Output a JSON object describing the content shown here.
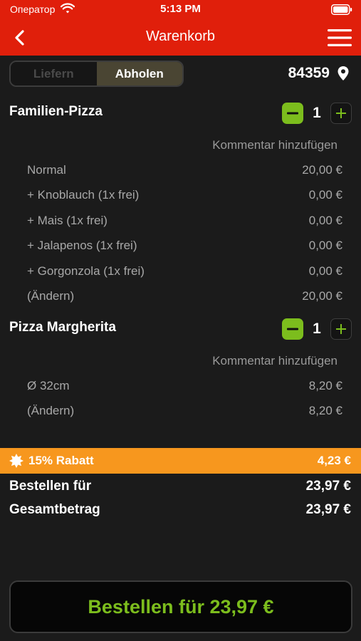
{
  "status_bar": {
    "carrier": "Оператор",
    "time": "5:13 PM"
  },
  "nav": {
    "title": "Warenkorb"
  },
  "mode": {
    "delivery": "Liefern",
    "pickup": "Abholen",
    "selected": "Abholen"
  },
  "location": {
    "zip": "84359"
  },
  "cart": {
    "items": [
      {
        "name": "Familien-Pizza",
        "quantity": "1",
        "comment": "Kommentar hinzufügen",
        "lines": [
          {
            "label": "Normal",
            "price": "20,00 €"
          },
          {
            "label": "+ Knoblauch (1x frei)",
            "price": "0,00 €"
          },
          {
            "label": "+ Mais (1x frei)",
            "price": "0,00 €"
          },
          {
            "label": "+ Jalapenos (1x frei)",
            "price": "0,00 €"
          },
          {
            "label": "+ Gorgonzola (1x frei)",
            "price": "0,00 €"
          },
          {
            "label": "(Ändern)",
            "price": "20,00 €"
          }
        ]
      },
      {
        "name": "Pizza Margherita",
        "quantity": "1",
        "comment": "Kommentar hinzufügen",
        "lines": [
          {
            "label": "Ø 32cm",
            "price": "8,20 €"
          },
          {
            "label": "(Ändern)",
            "price": "8,20 €"
          }
        ]
      }
    ]
  },
  "discount": {
    "label": "15% Rabatt",
    "value": "4,23 €"
  },
  "summary": {
    "order_for_label": "Bestellen für",
    "order_for_value": "23,97 €",
    "total_label": "Gesamtbetrag",
    "total_value": "23,97 €"
  },
  "order_button": {
    "label": "Bestellen für 23,97 €"
  },
  "colors": {
    "brand_red": "#e01f0b",
    "accent_green": "#7cbd1d",
    "discount_orange": "#f7971e",
    "background": "#1b1b1b"
  }
}
